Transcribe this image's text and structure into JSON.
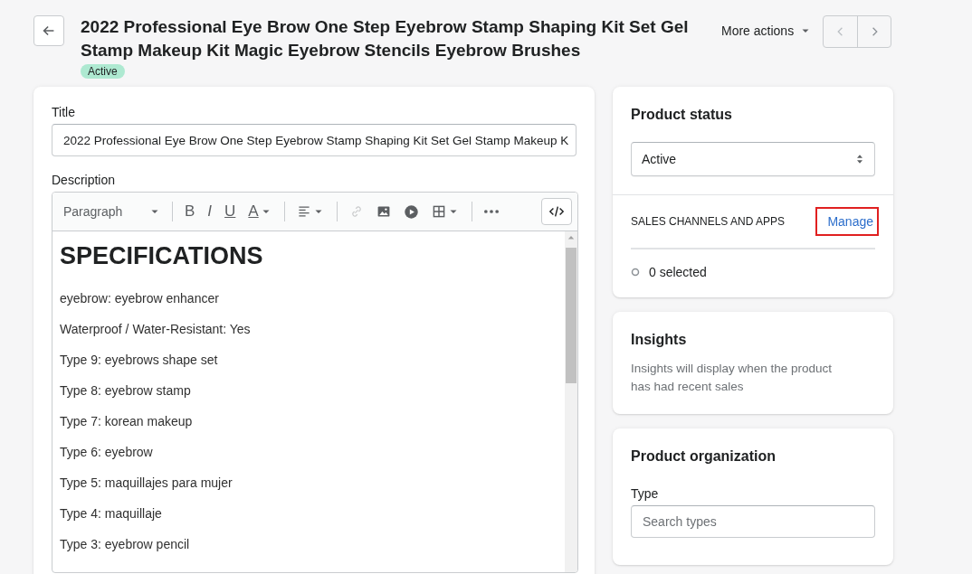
{
  "header": {
    "title": "2022 Professional Eye Brow One Step Eyebrow Stamp Shaping Kit Set Gel Stamp Makeup Kit Magic Eyebrow Stencils Eyebrow Brushes",
    "status_badge": "Active",
    "more_actions": "More actions"
  },
  "product_form": {
    "title_label": "Title",
    "title_value": "2022 Professional Eye Brow One Step Eyebrow Stamp Shaping Kit Set Gel Stamp Makeup K",
    "description_label": "Description",
    "toolbar": [
      {
        "kind": "format",
        "label": "Paragraph",
        "disabled": false
      },
      {
        "kind": "bold",
        "label": "B",
        "disabled": false
      },
      {
        "kind": "italic",
        "label": "I",
        "disabled": false
      },
      {
        "kind": "underline",
        "label": "U",
        "disabled": false
      },
      {
        "kind": "color",
        "label": "A",
        "disabled": false
      },
      {
        "kind": "align",
        "disabled": false
      },
      {
        "kind": "link",
        "disabled": true
      },
      {
        "kind": "image",
        "disabled": false
      },
      {
        "kind": "video",
        "disabled": false
      },
      {
        "kind": "table",
        "disabled": false
      },
      {
        "kind": "more",
        "disabled": false
      },
      {
        "kind": "code",
        "disabled": false
      }
    ],
    "content": [
      {
        "kind": "heading",
        "text": "SPECIFICATIONS"
      },
      {
        "kind": "paragraph",
        "text": "eyebrow: eyebrow enhancer"
      },
      {
        "kind": "paragraph",
        "text": "Waterproof / Water-Resistant: Yes"
      },
      {
        "kind": "paragraph",
        "text": "Type 9: eyebrows shape set"
      },
      {
        "kind": "paragraph",
        "text": "Type 8: eyebrow stamp"
      },
      {
        "kind": "paragraph",
        "text": "Type 7: korean makeup"
      },
      {
        "kind": "paragraph",
        "text": "Type 6: eyebrow"
      },
      {
        "kind": "paragraph",
        "text": "Type 5: maquillajes para mujer"
      },
      {
        "kind": "paragraph",
        "text": "Type 4: maquillaje"
      },
      {
        "kind": "paragraph",
        "text": "Type 3: eyebrow pencil"
      }
    ]
  },
  "product_status": {
    "title": "Product status",
    "status_value": "Active",
    "channels_heading": "SALES CHANNELS AND APPS",
    "manage_link": {
      "label": "Manage",
      "highlighted": true
    },
    "selected_count": "0 selected"
  },
  "insights": {
    "title": "Insights",
    "message": "Insights will display when the product has had recent sales"
  },
  "organization": {
    "title": "Product organization",
    "type_label": "Type",
    "type_placeholder": "Search types"
  }
}
